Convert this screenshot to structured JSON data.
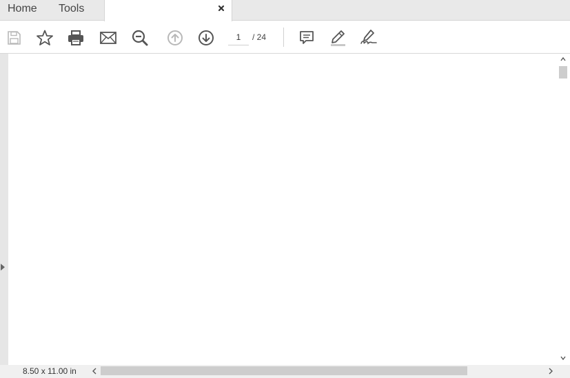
{
  "tabs": {
    "home_label": "Home",
    "tools_label": "Tools"
  },
  "toolbar": {
    "icons": [
      "save-icon",
      "star-icon",
      "print-icon",
      "email-icon",
      "zoom-out-icon",
      "page-up-icon",
      "page-down-icon",
      "comment-icon",
      "highlight-icon",
      "sign-icon"
    ],
    "current_page": "1",
    "page_total": "/ 24"
  },
  "status": {
    "page_size": "8.50 x 11.00 in"
  },
  "colors": {
    "icon": "#555555",
    "icon_disabled": "#b8b8b8",
    "tabbar_bg": "#e9e9e9",
    "scroll_thumb": "#cdcdcd"
  }
}
